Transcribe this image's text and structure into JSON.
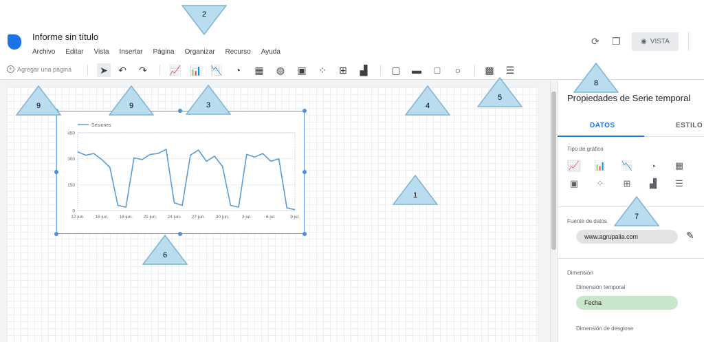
{
  "header": {
    "doc_title": "Informe sin título",
    "menu": [
      "Archivo",
      "Editar",
      "Vista",
      "Insertar",
      "Página",
      "Organizar",
      "Recurso",
      "Ayuda"
    ],
    "refresh_icon": "refresh-icon",
    "copy_icon": "copy-icon",
    "view_button_label": "VISTA",
    "view_icon": "eye-icon"
  },
  "toolbar": {
    "add_page_label": "Agregar una página"
  },
  "chart": {
    "legend": "Sesiones"
  },
  "chart_data": {
    "type": "line",
    "series": [
      {
        "name": "Sesiones",
        "values": [
          340,
          320,
          330,
          295,
          250,
          30,
          20,
          305,
          295,
          325,
          330,
          355,
          45,
          30,
          320,
          350,
          285,
          315,
          255,
          30,
          20,
          325,
          310,
          330,
          285,
          300,
          15,
          5
        ]
      }
    ],
    "x_ticks": [
      "12 jun.",
      "15 jun.",
      "18 jun.",
      "21 jun.",
      "24 jun.",
      "27 jun.",
      "30 jun.",
      "3 jul.",
      "6 jul.",
      "9 jul."
    ],
    "y_ticks": [
      "0",
      "150",
      "300",
      "450"
    ],
    "ylim": [
      0,
      450
    ],
    "color": "#5b9bd5"
  },
  "panel": {
    "title": "Propiedades de Serie temporal",
    "tab_data": "DATOS",
    "tab_style": "ESTILO",
    "chart_type_label": "Tipo de gráfico",
    "data_source_label": "Fuente de datos",
    "data_source_value": "www.agrupalia.com",
    "dimension_label": "Dimensión",
    "time_dimension_label": "Dimensión temporal",
    "time_dimension_value": "Fecha",
    "breakdown_label": "Dimensión de desglose"
  },
  "callouts": [
    "1",
    "2",
    "3",
    "4",
    "5",
    "6",
    "7",
    "8",
    "9",
    "9"
  ]
}
